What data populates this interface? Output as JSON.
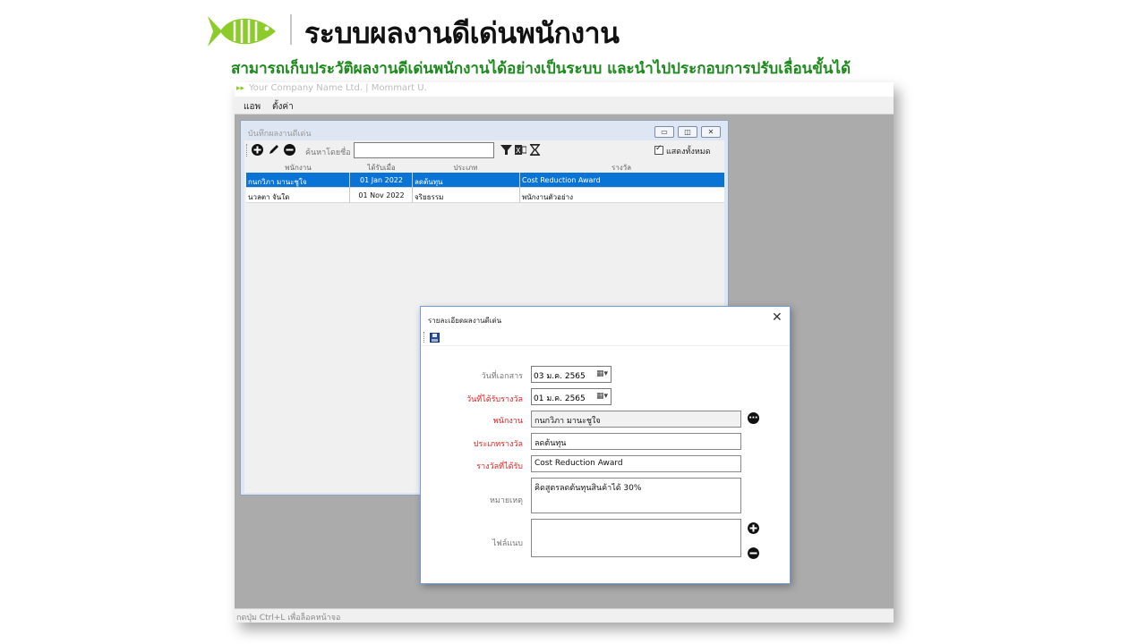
{
  "header": {
    "title": "ระบบผลงานดีเด่นพนักงาน",
    "subtitle": "สามารถเก็บประวัติผลงานดีเด่นพนักงานได้อย่างเป็นระบบ และนำไปประกอบการปรับเลื่อนขั้นได้",
    "accent_color": "#1c8a1c",
    "logo_color": "#8ccc2a"
  },
  "app": {
    "title": "Your Company Name Ltd. | Mommart U.",
    "menu": [
      "แอพ",
      "ตั้งค่า"
    ],
    "status": "กดปุ่ม Ctrl+L เพื่อล็อคหน้าจอ"
  },
  "list_window": {
    "title": "บันทึกผลงานดีเด่น",
    "search_label": "ค้นหาโดยชื่อ :",
    "search_value": "",
    "show_all_label": "แสดงทั้งหมด",
    "columns": [
      "พนักงาน",
      "ได้รับเมื่อ",
      "ประเภท",
      "รางวัล"
    ],
    "rows": [
      {
        "employee": "กนกวิภา มานะชูใจ",
        "date": "01 Jan 2022",
        "type": "ลดต้นทุน",
        "award": "Cost Reduction Award",
        "selected": true
      },
      {
        "employee": "นวลตา จันใด",
        "date": "01 Nov 2022",
        "type": "จริยธรรม",
        "award": "พนักงานตัวอย่าง",
        "selected": false
      }
    ]
  },
  "dialog": {
    "title": "รายละเอียดผลงานดีเด่น",
    "fields": {
      "doc_date": {
        "label": "วันที่เอกสาร",
        "value": "03 ม.ค.   2565"
      },
      "award_date": {
        "label": "วันที่ได้รับรางวัล",
        "value": "01 ม.ค.   2565"
      },
      "employee": {
        "label": "พนักงาน",
        "value": "กนกวิภา มานะชูใจ"
      },
      "award_type": {
        "label": "ประเภทรางวัล",
        "value": "ลดต้นทุน"
      },
      "award": {
        "label": "รางวัลที่ได้รับ",
        "value": "Cost Reduction Award"
      },
      "note": {
        "label": "หมายเหตุ",
        "value": "คิดสูตรลดต้นทุนสินค้าได้ 30%"
      },
      "attachment": {
        "label": "ไฟล์แนบ",
        "value": ""
      }
    }
  }
}
